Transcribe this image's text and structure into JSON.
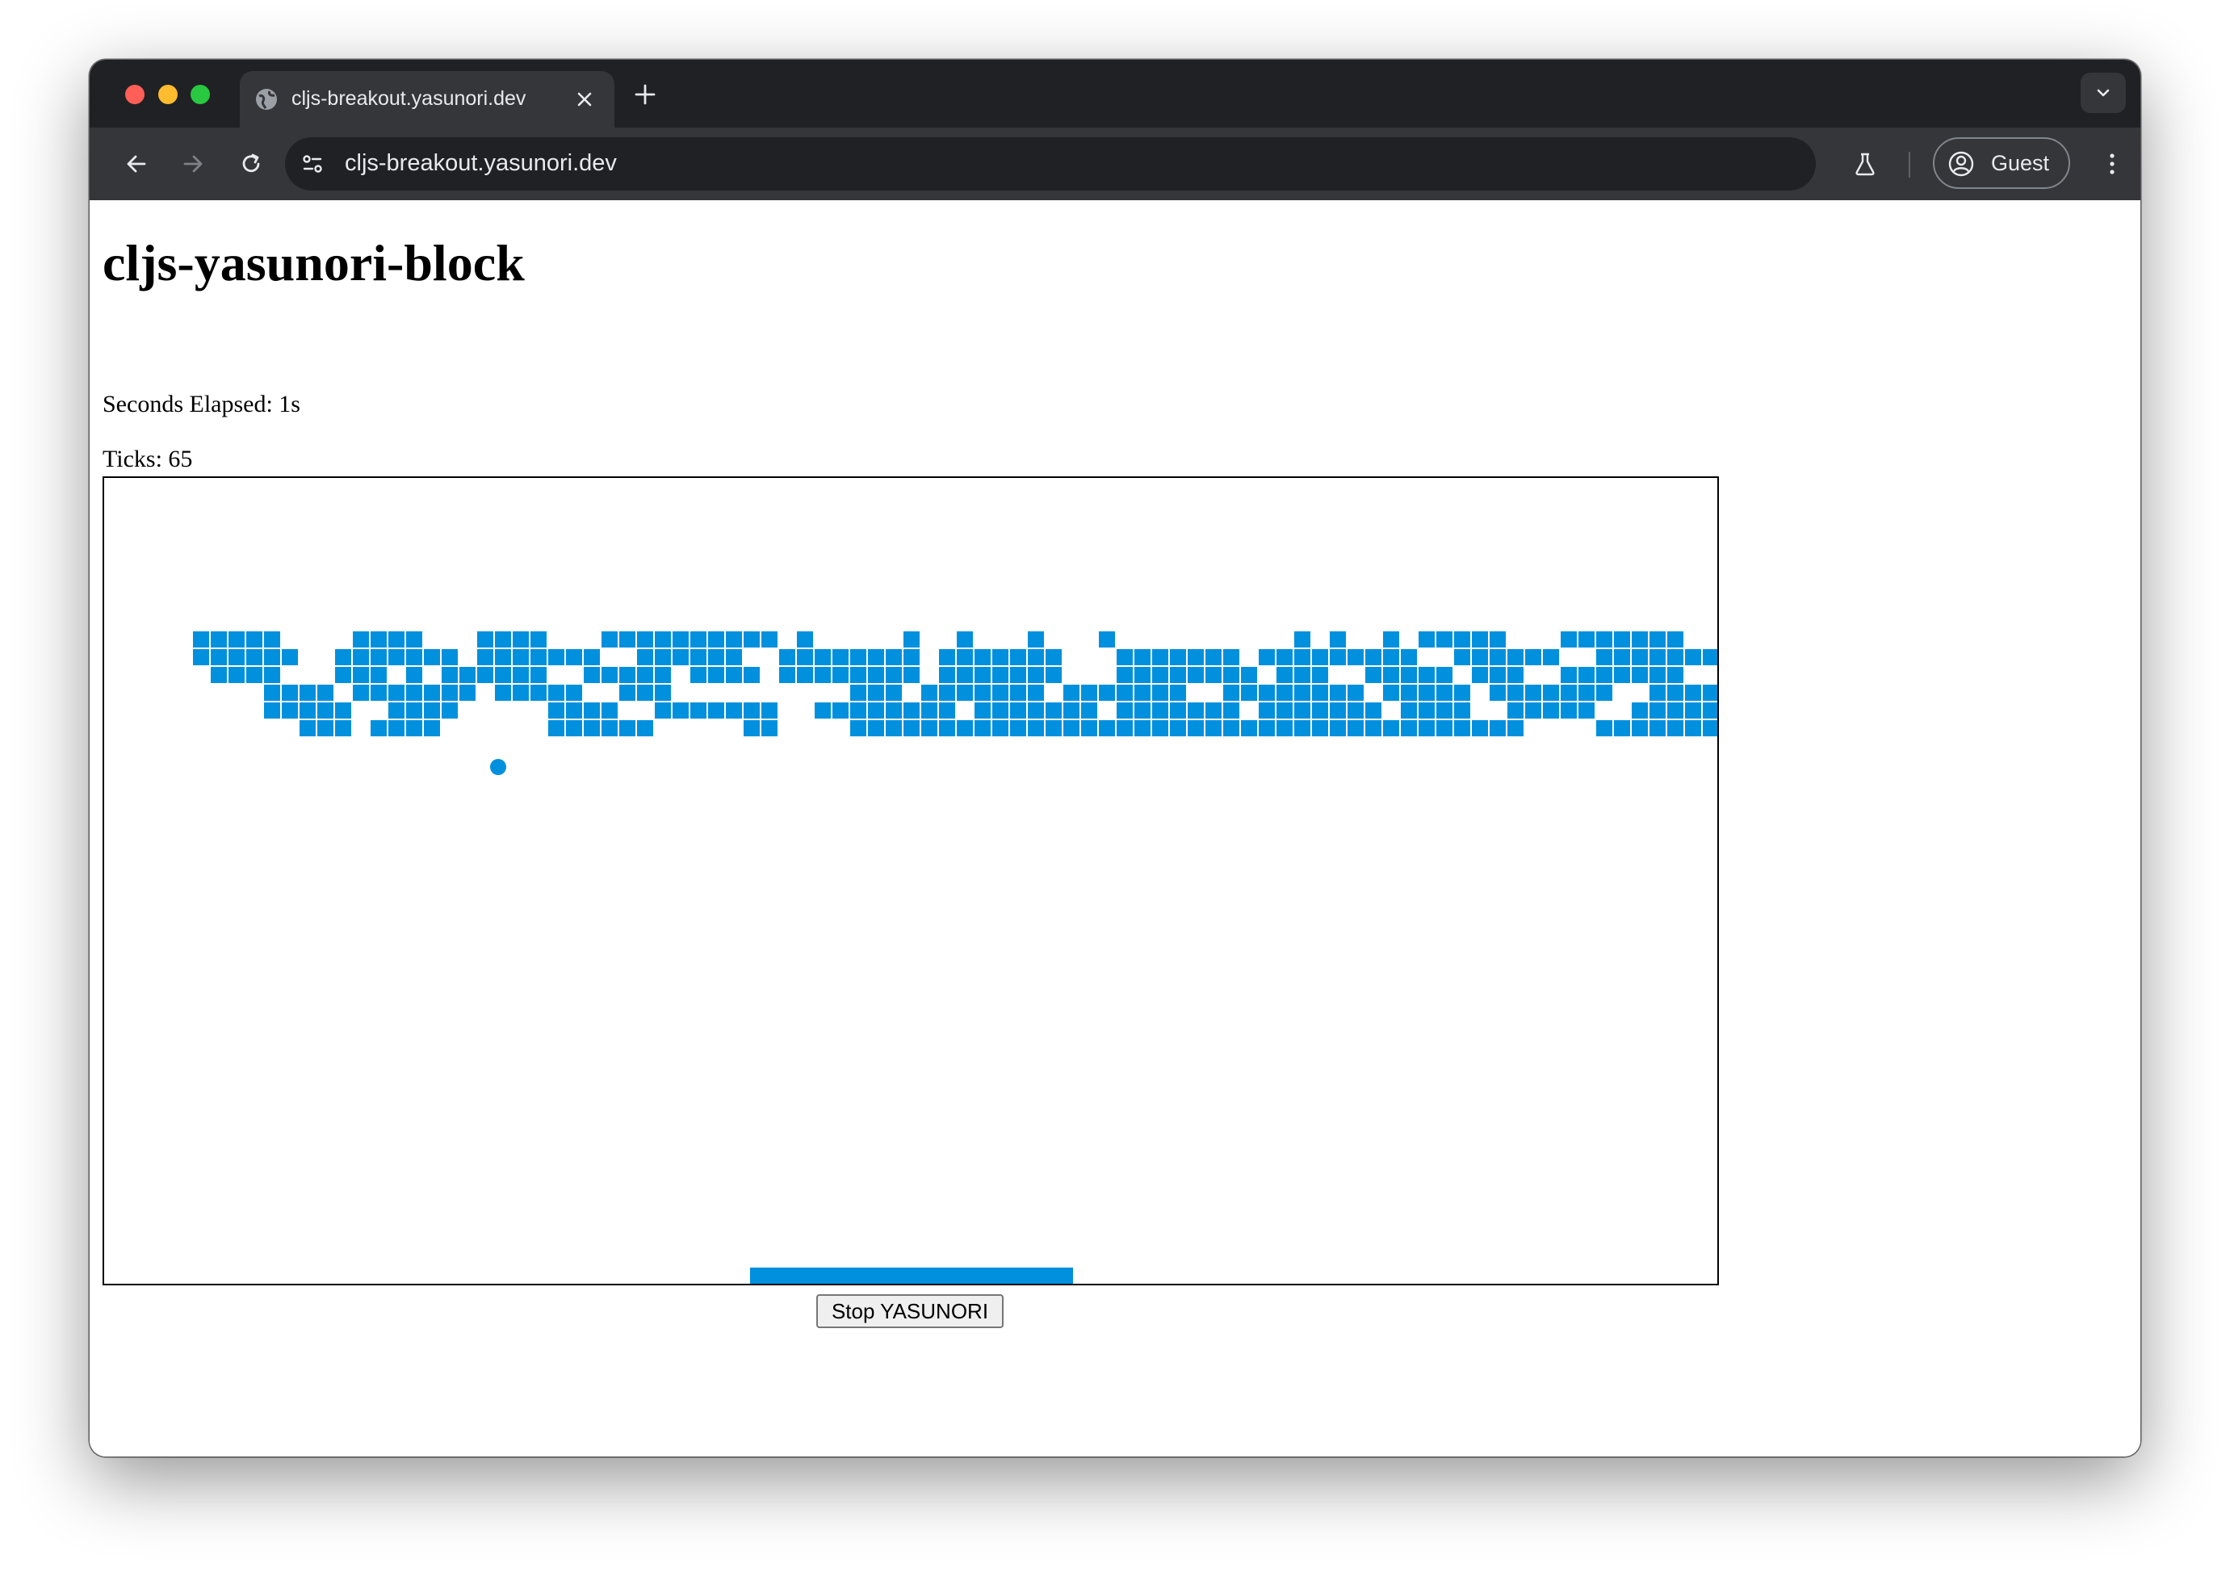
{
  "browser": {
    "tab_title": "cljs-breakout.yasunori.dev",
    "url": "cljs-breakout.yasunori.dev",
    "profile_label": "Guest"
  },
  "page": {
    "title": "cljs-yasunori-block",
    "seconds_elapsed": "Seconds Elapsed: 1s",
    "ticks": "Ticks: 65",
    "stop_button_label": "Stop YASUNORI"
  },
  "game": {
    "brick_color": "#0090dd",
    "ball_color": "#0090dd",
    "paddle_color": "#0090dd",
    "bricks": [
      "#####....####...####...##########.#.....#..#...#...#..........#.#..#.#####...#######.....#",
      "######..#######.#######..######..########.#######...#######.#########..######..########.....####",
      ".####...###.#.######..#####.####.########.#######...########.###..#####.###..#######....#####",
      "....####.#######.#####..###..........###.#######.#######..########.#####.#######..####..#####",
      "....#####..####.....####..#######..########.#######.#######.#######.####..#####..#######.#####",
      "......###.####......######.....##....######################################....#######.#####"
    ]
  }
}
